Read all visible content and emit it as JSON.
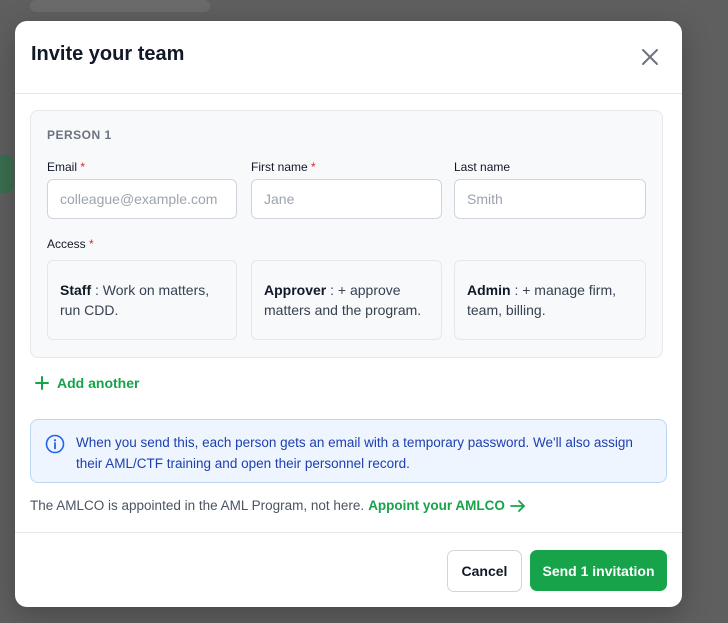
{
  "modal": {
    "title": "Invite your team",
    "close_icon": "close-icon"
  },
  "person": {
    "label": "PERSON 1",
    "email": {
      "label": "Email",
      "required": "*",
      "placeholder": "colleague@example.com",
      "value": ""
    },
    "first_name": {
      "label": "First name",
      "required": "*",
      "placeholder": "Jane",
      "value": ""
    },
    "last_name": {
      "label": "Last name",
      "placeholder": "Smith",
      "value": ""
    },
    "access": {
      "label": "Access",
      "required": "*",
      "options": [
        {
          "name": "Staff",
          "sep": " : ",
          "desc": "Work on matters, run CDD."
        },
        {
          "name": "Approver",
          "sep": " : ",
          "desc": "+ approve matters and the program."
        },
        {
          "name": "Admin",
          "sep": " : ",
          "desc": "+ manage firm, team, billing."
        }
      ]
    }
  },
  "add_another": {
    "label": "Add another",
    "icon": "plus-icon"
  },
  "info": {
    "icon": "info-icon",
    "text": "When you send this, each person gets an email with a temporary password. We'll also assign their AML/CTF training and open their personnel record."
  },
  "amlco": {
    "text": "The AMLCO is appointed in the AML Program, not here.",
    "link_label": "Appoint your AMLCO",
    "link_icon": "arrow-right-icon"
  },
  "footer": {
    "cancel_label": "Cancel",
    "send_label": "Send 1 invitation"
  },
  "colors": {
    "accent": "#16a34a",
    "required": "#dc2626",
    "info_text": "#1e40af",
    "info_bg": "#eef5ff"
  }
}
